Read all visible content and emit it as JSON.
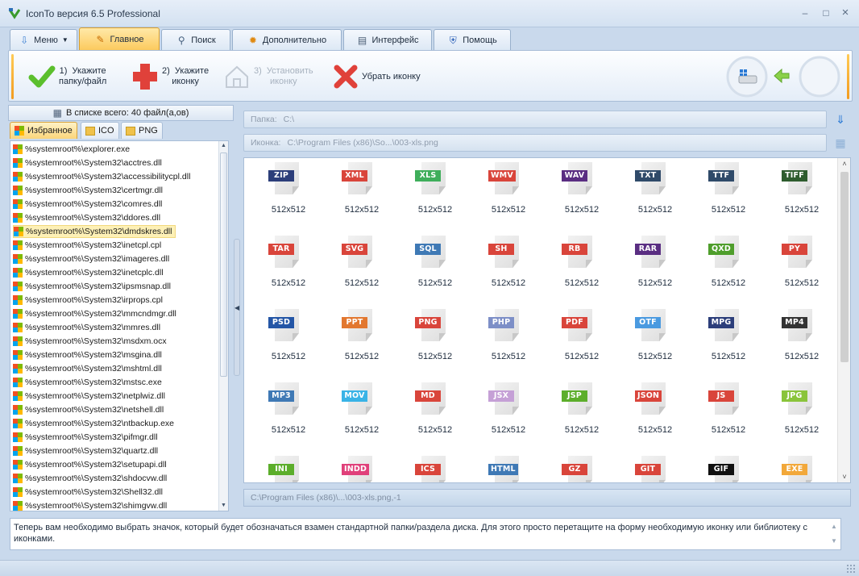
{
  "window": {
    "title": "IconTo версия 6.5 Professional",
    "minimize": "–",
    "maximize": "□",
    "close": "×"
  },
  "tabs": [
    {
      "label": "Меню",
      "icon": "arrow-down-icon"
    },
    {
      "label": "Главное",
      "icon": "brush-icon",
      "active": true
    },
    {
      "label": "Поиск",
      "icon": "magnifier-icon"
    },
    {
      "label": "Дополнительно",
      "icon": "gear-icon"
    },
    {
      "label": "Интерфейс",
      "icon": "window-icon"
    },
    {
      "label": "Помощь",
      "icon": "shield-icon"
    }
  ],
  "ribbon": {
    "step1": "1)  Укажите\nпапку/файл",
    "step2": "2)  Укажите\nиконку",
    "step3": "3)  Установить\nиконку",
    "remove": "Убрать иконку"
  },
  "left": {
    "count": "В списке всего: 40 файл(а,ов)",
    "subtabs": [
      "Избранное",
      "ICO",
      "PNG"
    ],
    "files": [
      "%systemroot%\\explorer.exe",
      "%systemroot%\\System32\\acctres.dll",
      "%systemroot%\\System32\\accessibilitycpl.dll",
      "%systemroot%\\System32\\certmgr.dll",
      "%systemroot%\\System32\\comres.dll",
      "%systemroot%\\System32\\ddores.dll",
      "%systemroot%\\System32\\dmdskres.dll",
      "%systemroot%\\System32\\inetcpl.cpl",
      "%systemroot%\\System32\\imageres.dll",
      "%systemroot%\\System32\\inetcplc.dll",
      "%systemroot%\\System32\\ipsmsnap.dll",
      "%systemroot%\\System32\\irprops.cpl",
      "%systemroot%\\System32\\mmcndmgr.dll",
      "%systemroot%\\System32\\mmres.dll",
      "%systemroot%\\System32\\msdxm.ocx",
      "%systemroot%\\System32\\msgina.dll",
      "%systemroot%\\System32\\mshtml.dll",
      "%systemroot%\\System32\\mstsc.exe",
      "%systemroot%\\System32\\netplwiz.dll",
      "%systemroot%\\System32\\netshell.dll",
      "%systemroot%\\System32\\ntbackup.exe",
      "%systemroot%\\System32\\pifmgr.dll",
      "%systemroot%\\System32\\quartz.dll",
      "%systemroot%\\System32\\setupapi.dll",
      "%systemroot%\\System32\\shdocvw.dll",
      "%systemroot%\\System32\\Shell32.dll",
      "%systemroot%\\System32\\shimgvw.dll"
    ],
    "selected_index": 6
  },
  "right": {
    "folder_label": "Папка:",
    "folder_value": "C:\\",
    "icon_label": "Иконка:",
    "icon_value": "C:\\Program Files (x86)\\So...\\003-xls.png",
    "size_label": "512x512",
    "icons": [
      {
        "ext": "ZIP",
        "color": "#2c3e7a"
      },
      {
        "ext": "XML",
        "color": "#d9453b"
      },
      {
        "ext": "XLS",
        "color": "#3fae5b"
      },
      {
        "ext": "WMV",
        "color": "#d9453b"
      },
      {
        "ext": "WAV",
        "color": "#5a2e82"
      },
      {
        "ext": "TXT",
        "color": "#2f4a69"
      },
      {
        "ext": "TTF",
        "color": "#2f4a69"
      },
      {
        "ext": "TIFF",
        "color": "#2e5c2e"
      },
      {
        "ext": "TAR",
        "color": "#d9453b"
      },
      {
        "ext": "SVG",
        "color": "#d9453b"
      },
      {
        "ext": "SQL",
        "color": "#3f79b5"
      },
      {
        "ext": "SH",
        "color": "#d9453b"
      },
      {
        "ext": "RB",
        "color": "#d9453b"
      },
      {
        "ext": "RAR",
        "color": "#5a2e82"
      },
      {
        "ext": "QXD",
        "color": "#4f9e2c"
      },
      {
        "ext": "PY",
        "color": "#d9453b"
      },
      {
        "ext": "PSD",
        "color": "#2456a6"
      },
      {
        "ext": "PPT",
        "color": "#e2772f"
      },
      {
        "ext": "PNG",
        "color": "#d9453b"
      },
      {
        "ext": "PHP",
        "color": "#7d8fc7"
      },
      {
        "ext": "PDF",
        "color": "#d9453b"
      },
      {
        "ext": "OTF",
        "color": "#4a9ae0"
      },
      {
        "ext": "MPG",
        "color": "#2c3e7a"
      },
      {
        "ext": "MP4",
        "color": "#333333"
      },
      {
        "ext": "MP3",
        "color": "#3f79b5"
      },
      {
        "ext": "MOV",
        "color": "#39b3e6"
      },
      {
        "ext": "MD",
        "color": "#d9453b"
      },
      {
        "ext": "JSX",
        "color": "#c5a0d6"
      },
      {
        "ext": "JSP",
        "color": "#5cae2b"
      },
      {
        "ext": "JSON",
        "color": "#d9453b"
      },
      {
        "ext": "JS",
        "color": "#d9453b"
      },
      {
        "ext": "JPG",
        "color": "#8ac43b"
      },
      {
        "ext": "INI",
        "color": "#5cae2b"
      },
      {
        "ext": "INDD",
        "color": "#e0407a"
      },
      {
        "ext": "ICS",
        "color": "#d9453b"
      },
      {
        "ext": "HTML",
        "color": "#3f79b5"
      },
      {
        "ext": "GZ",
        "color": "#d9453b"
      },
      {
        "ext": "GIT",
        "color": "#d9453b"
      },
      {
        "ext": "GIF",
        "color": "#111111"
      },
      {
        "ext": "EXE",
        "color": "#f2a83a"
      }
    ],
    "path_bar": "C:\\Program Files (x86)\\...\\003-xls.png,-1"
  },
  "hint": "Теперь вам необходимо выбрать значок, который будет обозначаться взамен стандартной папки/раздела диска. Для этого просто перетащите на форму необходимую иконку или библиотеку с иконками."
}
